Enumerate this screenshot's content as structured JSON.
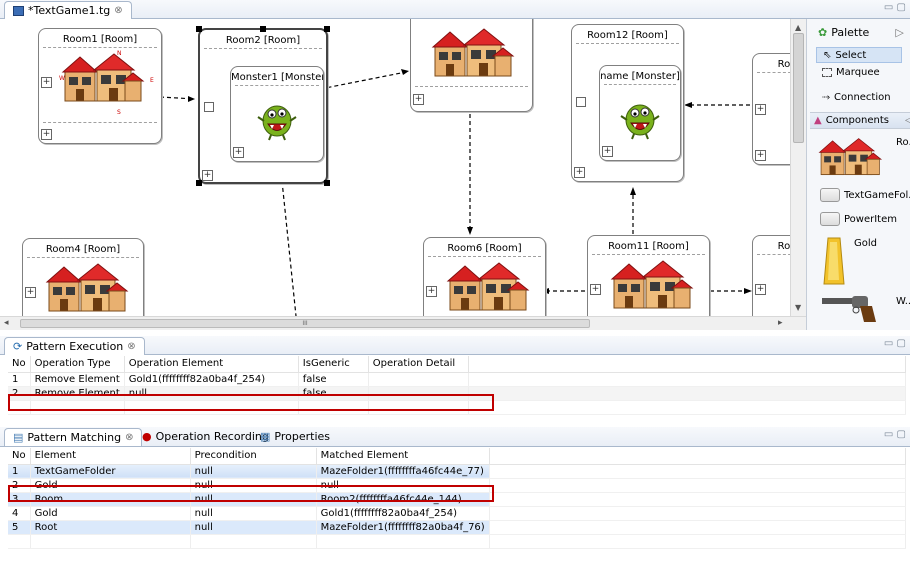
{
  "editor": {
    "tab_label": "*TextGame1.tg",
    "close": "⊗"
  },
  "canvas": {
    "rooms": [
      {
        "id": "room1",
        "title": "Room1 [Room]"
      },
      {
        "id": "room2",
        "title": "Room2 [Room]",
        "monster": "Monster1 [Monster]"
      },
      {
        "id": "room12",
        "title": "Room12 [Room]",
        "monster": "name [Monster]"
      },
      {
        "id": "room4",
        "title": "Room4 [Room]"
      },
      {
        "id": "room6",
        "title": "Room6 [Room]"
      },
      {
        "id": "room11",
        "title": "Room11 [Room]"
      },
      {
        "id": "roomR1",
        "title": "Roo"
      },
      {
        "id": "roomR2",
        "title": "Roo"
      }
    ],
    "house_labels": {
      "n": "N",
      "w": "W",
      "e": "E",
      "s": "S"
    },
    "scroll_grip": "III"
  },
  "palette": {
    "title": "Palette",
    "select": "Select",
    "marquee": "Marquee",
    "connection": "Connection",
    "components": "Components",
    "items": [
      "Ro.",
      "TextGameFol..",
      "PowerItem",
      "Gold",
      "W.."
    ]
  },
  "pattern_execution": {
    "tab": "Pattern Execution",
    "columns": [
      "No",
      "Operation Type",
      "Operation Element",
      "IsGeneric",
      "Operation Detail"
    ],
    "rows": [
      [
        "1",
        "Remove Element",
        "Gold1(ffffffff82a0ba4f_254)",
        "false",
        ""
      ],
      [
        "2",
        "Remove Element",
        "null",
        "false",
        ""
      ]
    ]
  },
  "bottom_tabs": {
    "matching": "Pattern Matching",
    "recording": "Operation Recording",
    "properties": "Properties"
  },
  "pattern_matching": {
    "columns": [
      "No",
      "Element",
      "Precondition",
      "Matched Element"
    ],
    "rows": [
      [
        "1",
        "TextGameFolder",
        "null",
        "MazeFolder1(ffffffffa46fc44e_77)"
      ],
      [
        "2",
        "Gold",
        "null",
        "null"
      ],
      [
        "3",
        "Room",
        "null",
        "Room2(ffffffffa46fc44e_144)"
      ],
      [
        "4",
        "Gold",
        "null",
        "Gold1(ffffffff82a0ba4f_254)"
      ],
      [
        "5",
        "Root",
        "null",
        "MazeFolder1(ffffffff82a0ba4f_76)"
      ]
    ]
  },
  "colors": {
    "highlight": "#c00000",
    "selection": "#dbe9fb"
  }
}
